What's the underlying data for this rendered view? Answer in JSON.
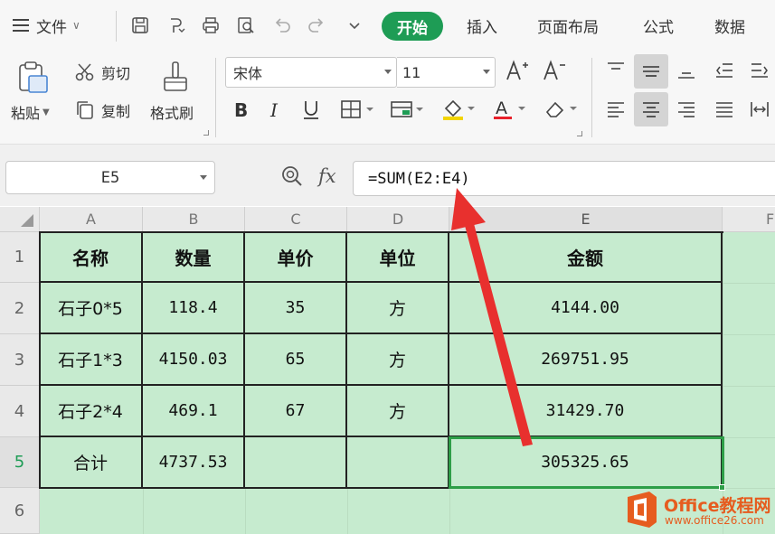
{
  "menubar": {
    "file_label": "文件",
    "tabs": [
      "开始",
      "插入",
      "页面布局",
      "公式",
      "数据"
    ],
    "active_tab": "开始",
    "accent": "#1e9c55"
  },
  "ribbon": {
    "paste_label": "粘贴",
    "cut_label": "剪切",
    "copy_label": "复制",
    "format_painter_label": "格式刷",
    "font_name": "宋体",
    "font_size": "11"
  },
  "formula_bar": {
    "name_box": "E5",
    "fx_label": "fx",
    "formula": "=SUM(E2:E4)"
  },
  "grid": {
    "columns": [
      "A",
      "B",
      "C",
      "D",
      "E",
      "F"
    ],
    "rows": [
      "1",
      "2",
      "3",
      "4",
      "5",
      "6"
    ],
    "selected_cell": "E5",
    "cell_fill": "#c6ebcf",
    "cells": [
      [
        "名称",
        "数量",
        "单价",
        "单位",
        "金额"
      ],
      [
        "石子0*5",
        "118.4",
        "35",
        "方",
        "4144.00"
      ],
      [
        "石子1*3",
        "4150.03",
        "65",
        "方",
        "269751.95"
      ],
      [
        "石子2*4",
        "469.1",
        "67",
        "方",
        "31429.70"
      ],
      [
        "合计",
        "4737.53",
        "",
        "",
        "305325.65"
      ]
    ]
  },
  "watermark": {
    "brand": "Office教程网",
    "url": "www.office26.com"
  }
}
